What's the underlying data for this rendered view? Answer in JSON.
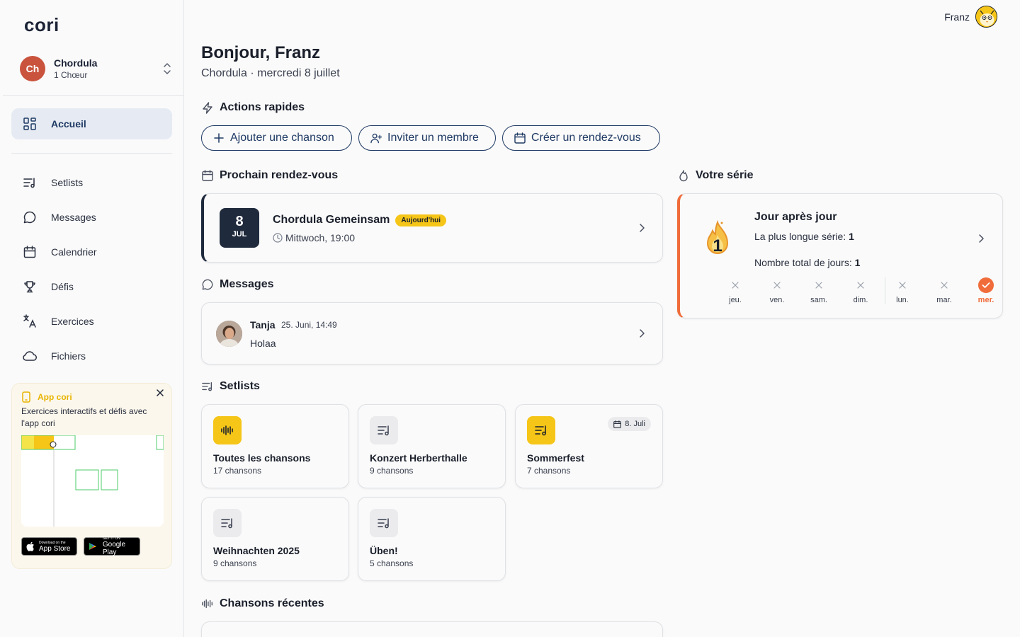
{
  "app": {
    "logo": "cori"
  },
  "org": {
    "initials": "Ch",
    "name": "Chordula",
    "sub": "1 Chœur"
  },
  "nav": {
    "home": "Accueil",
    "setlists": "Setlists",
    "messages": "Messages",
    "calendar": "Calendrier",
    "challenges": "Défis",
    "exercises": "Exercices",
    "files": "Fichiers"
  },
  "promo": {
    "title": "App cori",
    "text": "Exercices interactifs et défis avec l'app cori",
    "appstore_small": "Download on the",
    "appstore_big": "App Store",
    "googleplay_small": "GET IT ON",
    "googleplay_big": "Google Play"
  },
  "user": {
    "name": "Franz"
  },
  "greeting": {
    "title": "Bonjour, Franz",
    "subtitle": "Chordula · mercredi 8 juillet"
  },
  "quick": {
    "title": "Actions rapides",
    "add_song": "Ajouter une chanson",
    "invite": "Inviter un membre",
    "create_event": "Créer un rendez-vous"
  },
  "next_event": {
    "title": "Prochain rendez-vous",
    "day": "8",
    "month": "JUL",
    "name": "Chordula Gemeinsam",
    "badge": "Aujourd'hui",
    "time": "Mittwoch, 19:00"
  },
  "messages": {
    "title": "Messages",
    "author": "Tanja",
    "date": "25. Juni, 14:49",
    "text": "Holaa"
  },
  "setlists": {
    "title": "Setlists",
    "items": [
      {
        "title": "Toutes les chansons",
        "sub": "17 chansons"
      },
      {
        "title": "Konzert Herberthalle",
        "sub": "9 chansons"
      },
      {
        "title": "Sommerfest",
        "sub": "7 chansons",
        "date": "8. Juli"
      },
      {
        "title": "Weihnachten 2025",
        "sub": "9 chansons"
      },
      {
        "title": "Üben!",
        "sub": "5 chansons"
      }
    ]
  },
  "recent": {
    "title": "Chansons récentes"
  },
  "streak": {
    "title": "Votre série",
    "heading": "Jour après jour",
    "longest_label": "La plus longue série: ",
    "longest_value": "1",
    "total_label": "Nombre total de jours: ",
    "total_value": "1",
    "current": "1",
    "days": [
      "jeu.",
      "ven.",
      "sam.",
      "dim.",
      "lun.",
      "mar.",
      "mer."
    ],
    "accent": "#f06c3a"
  },
  "colors": {
    "primary": "#1f3a64",
    "yellow": "#f5c518",
    "org_avatar": "#c9533d"
  }
}
